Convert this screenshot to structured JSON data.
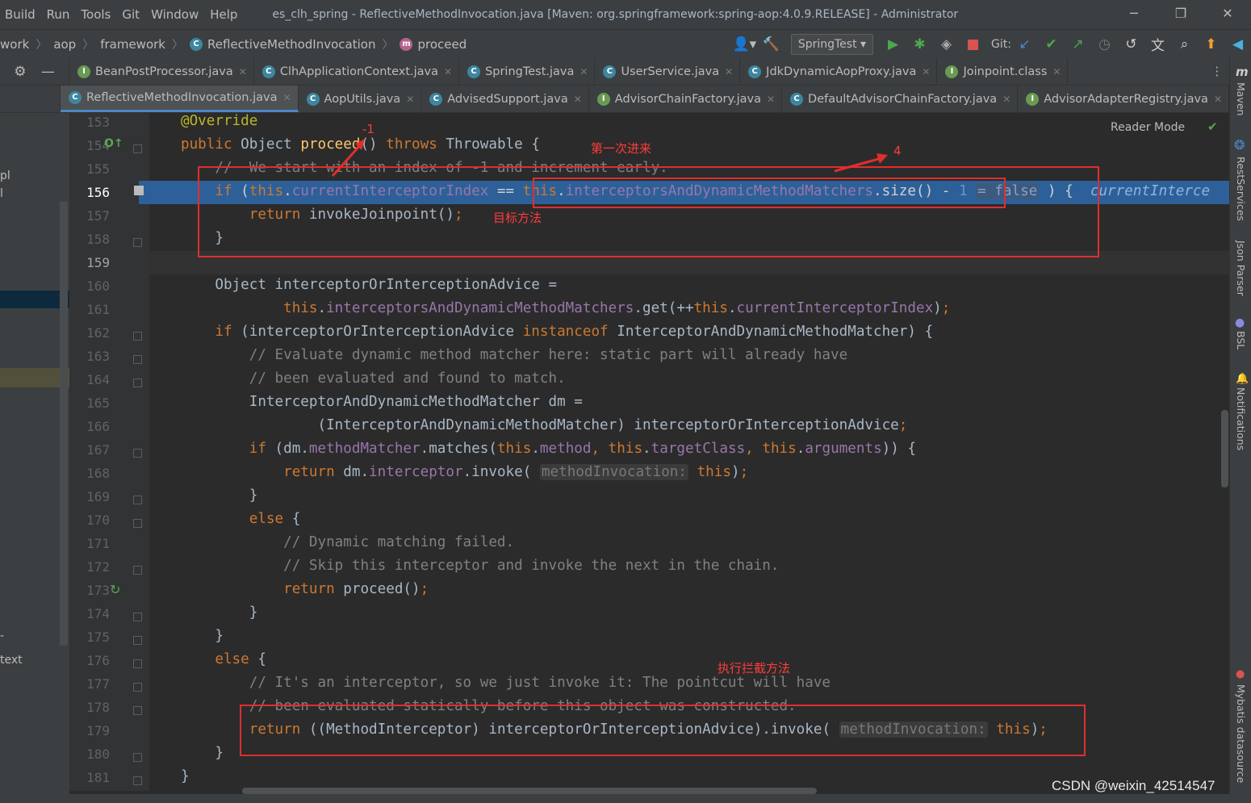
{
  "menubar": {
    "items": [
      "Build",
      "Run",
      "Tools",
      "Git",
      "Window",
      "Help"
    ],
    "title": "es_clh_spring - ReflectiveMethodInvocation.java [Maven: org.springframework:spring-aop:4.0.9.RELEASE] - Administrator",
    "window_buttons": [
      "─",
      "❐",
      "✕"
    ]
  },
  "breadcrumb": {
    "items": [
      "work",
      "aop",
      "framework",
      "ReflectiveMethodInvocation",
      "proceed"
    ]
  },
  "toolbar": {
    "run_config": "SpringTest",
    "git_label": "Git:"
  },
  "tabs_row1": [
    "BeanPostProcessor.java",
    "ClhApplicationContext.java",
    "SpringTest.java",
    "UserService.java",
    "JdkDynamicAopProxy.java",
    "Joinpoint.class"
  ],
  "tabs_row2": [
    "ReflectiveMethodInvocation.java",
    "AopUtils.java",
    "AdvisedSupport.java",
    "AdvisorChainFactory.java",
    "DefaultAdvisorChainFactory.java",
    "AdvisorAdapterRegistry.java"
  ],
  "editor": {
    "reader_mode": "Reader Mode",
    "line_numbers": [
      "153",
      "154",
      "155",
      "156",
      "157",
      "158",
      "159",
      "160",
      "161",
      "162",
      "163",
      "164",
      "165",
      "166",
      "167",
      "168",
      "169",
      "170",
      "171",
      "172",
      "173",
      "174",
      "175",
      "176",
      "177",
      "178",
      "179",
      "180",
      "181"
    ],
    "inline_hint_value": "= false",
    "debug_trail": "currentInterce",
    "param_hint": "methodInvocation:"
  },
  "left_panel": {
    "labels": [
      "pl",
      "l",
      "-",
      "text"
    ]
  },
  "right_panel": {
    "labels": [
      "Maven",
      "RestServices",
      "Json Parser",
      "BSL",
      "Notifications",
      "Mybatis datasource"
    ]
  },
  "annotations": {
    "minus_one": "-1",
    "four": "4",
    "first_entry": "第一次进来",
    "target_method": "目标方法",
    "execute_interceptor": "执行拦截方法"
  },
  "watermark": "CSDN @weixin_42514547",
  "colors": {
    "red_annotation": "#e02e2e",
    "highlight_line": "#2d6099"
  }
}
